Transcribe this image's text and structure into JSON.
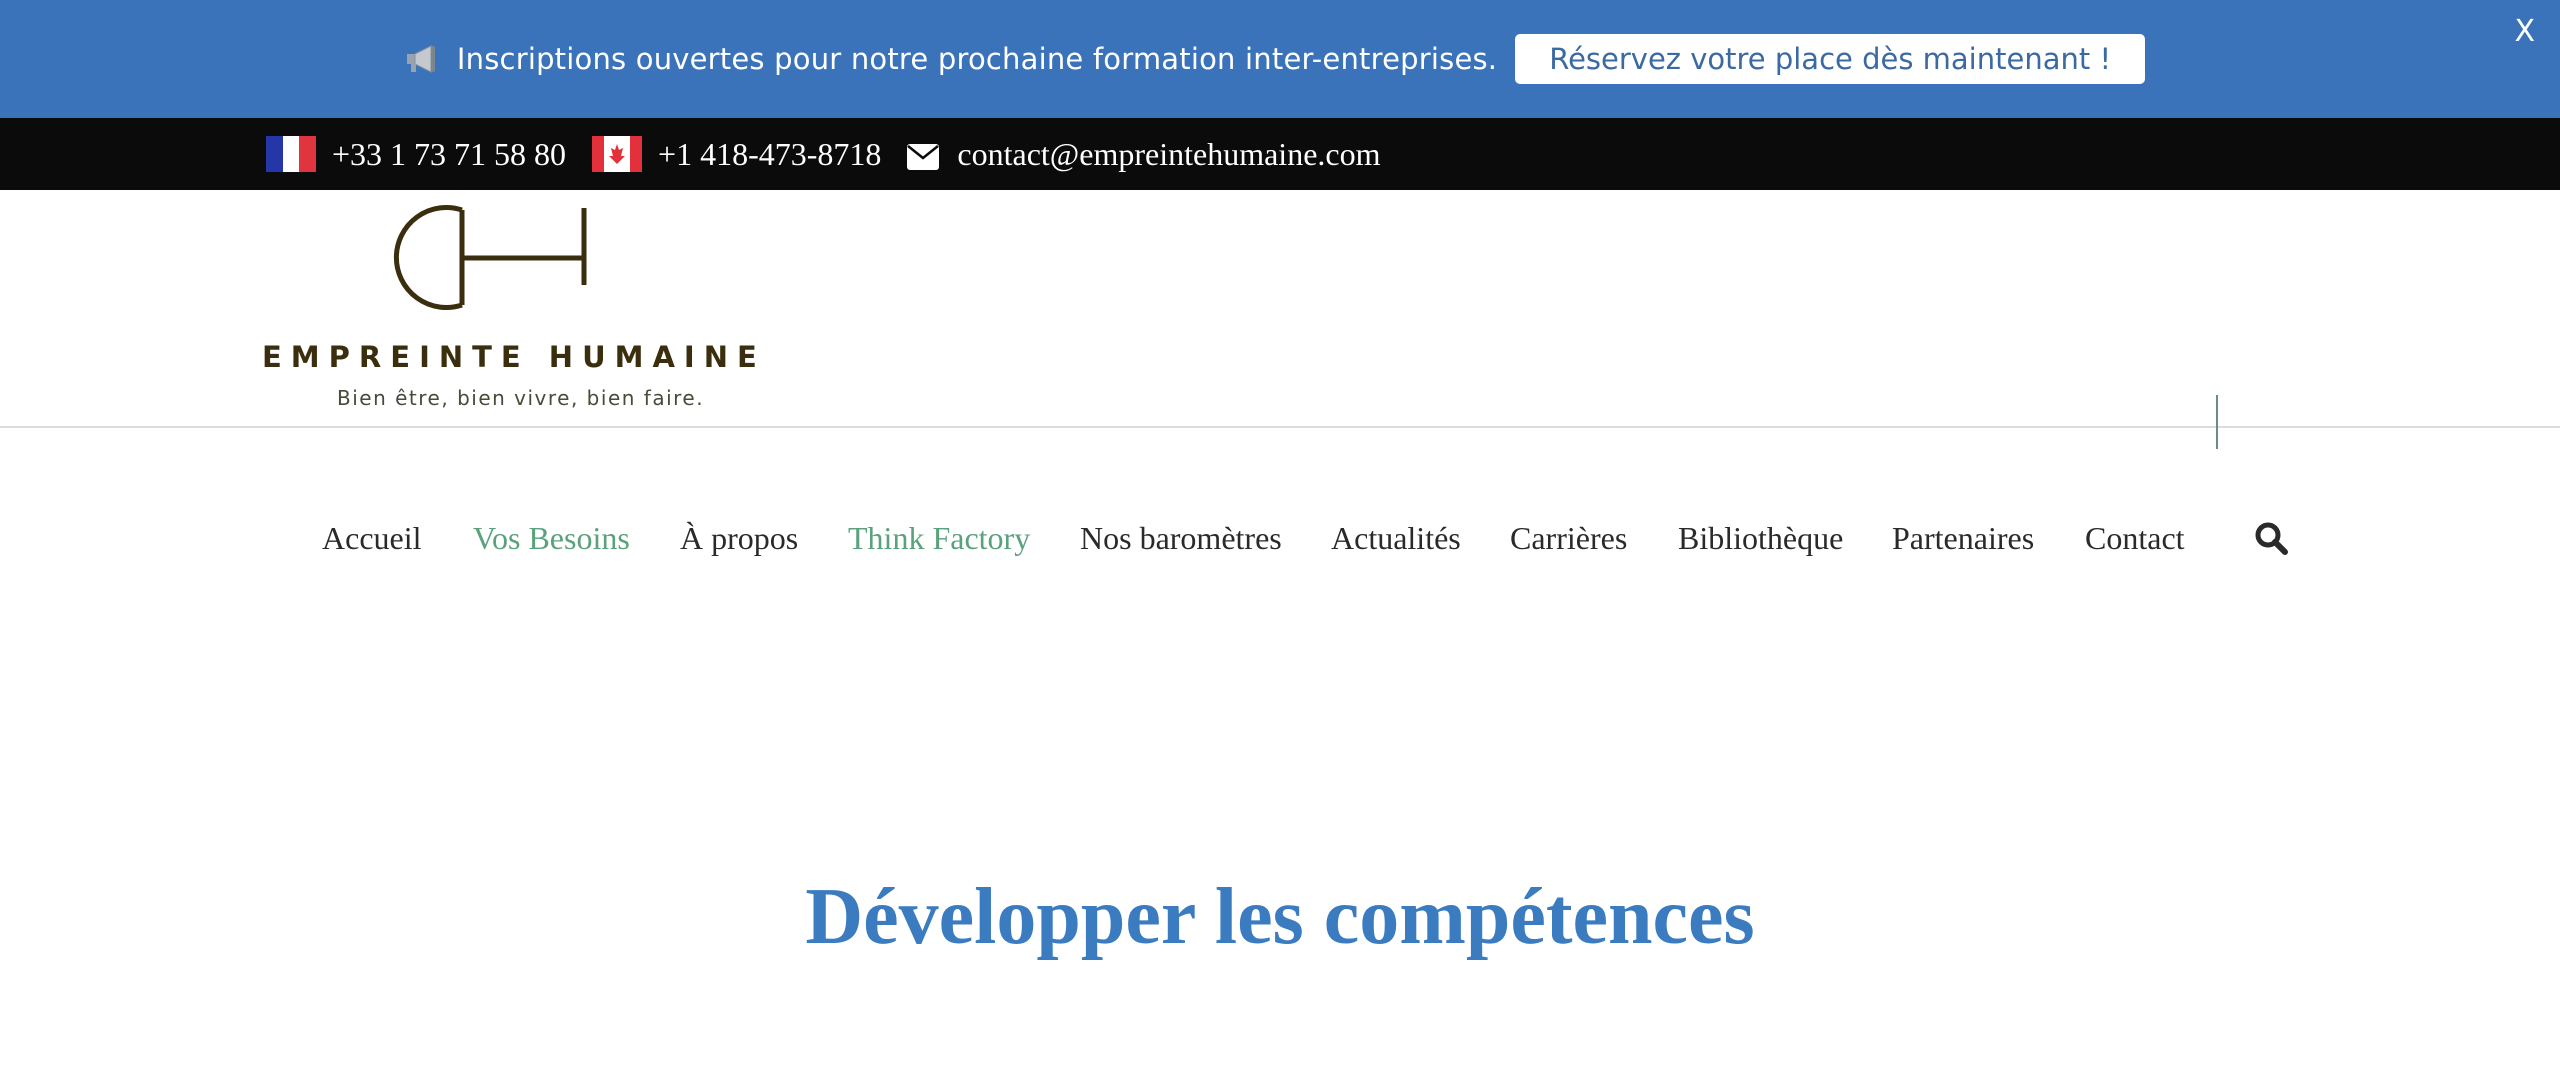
{
  "announcement": {
    "text": "Inscriptions ouvertes pour notre prochaine formation inter-entreprises.",
    "button_label": "Réservez votre place dès maintenant !",
    "close_label": "X",
    "icon": "megaphone-icon"
  },
  "contact": {
    "france_phone": "+33 1 73 71 58 80",
    "canada_phone": "+1 418-473-8718",
    "email": "contact@empreintehumaine.com"
  },
  "brand": {
    "monogram": "AH",
    "name": "EMPREINTE HUMAINE",
    "tagline": "Bien être, bien vivre, bien faire."
  },
  "nav": {
    "items": [
      {
        "label": "Accueil"
      },
      {
        "label": "Vos Besoins"
      },
      {
        "label": "À propos"
      },
      {
        "label": "Think Factory"
      },
      {
        "label": "Nos baromètres"
      },
      {
        "label": "Actualités"
      },
      {
        "label": "Carrières"
      },
      {
        "label": "Bibliothèque"
      },
      {
        "label": "Partenaires"
      },
      {
        "label": "Contact"
      }
    ],
    "search_icon": "search-icon"
  },
  "hero": {
    "title": "Développer les compétences"
  },
  "colors": {
    "announce_bg": "#3b73bb",
    "contact_bar_bg": "#0b0b0b",
    "nav_accent": "#5aa17d",
    "hero_title": "#3b7cc0",
    "brand": "#3a2e0e"
  }
}
